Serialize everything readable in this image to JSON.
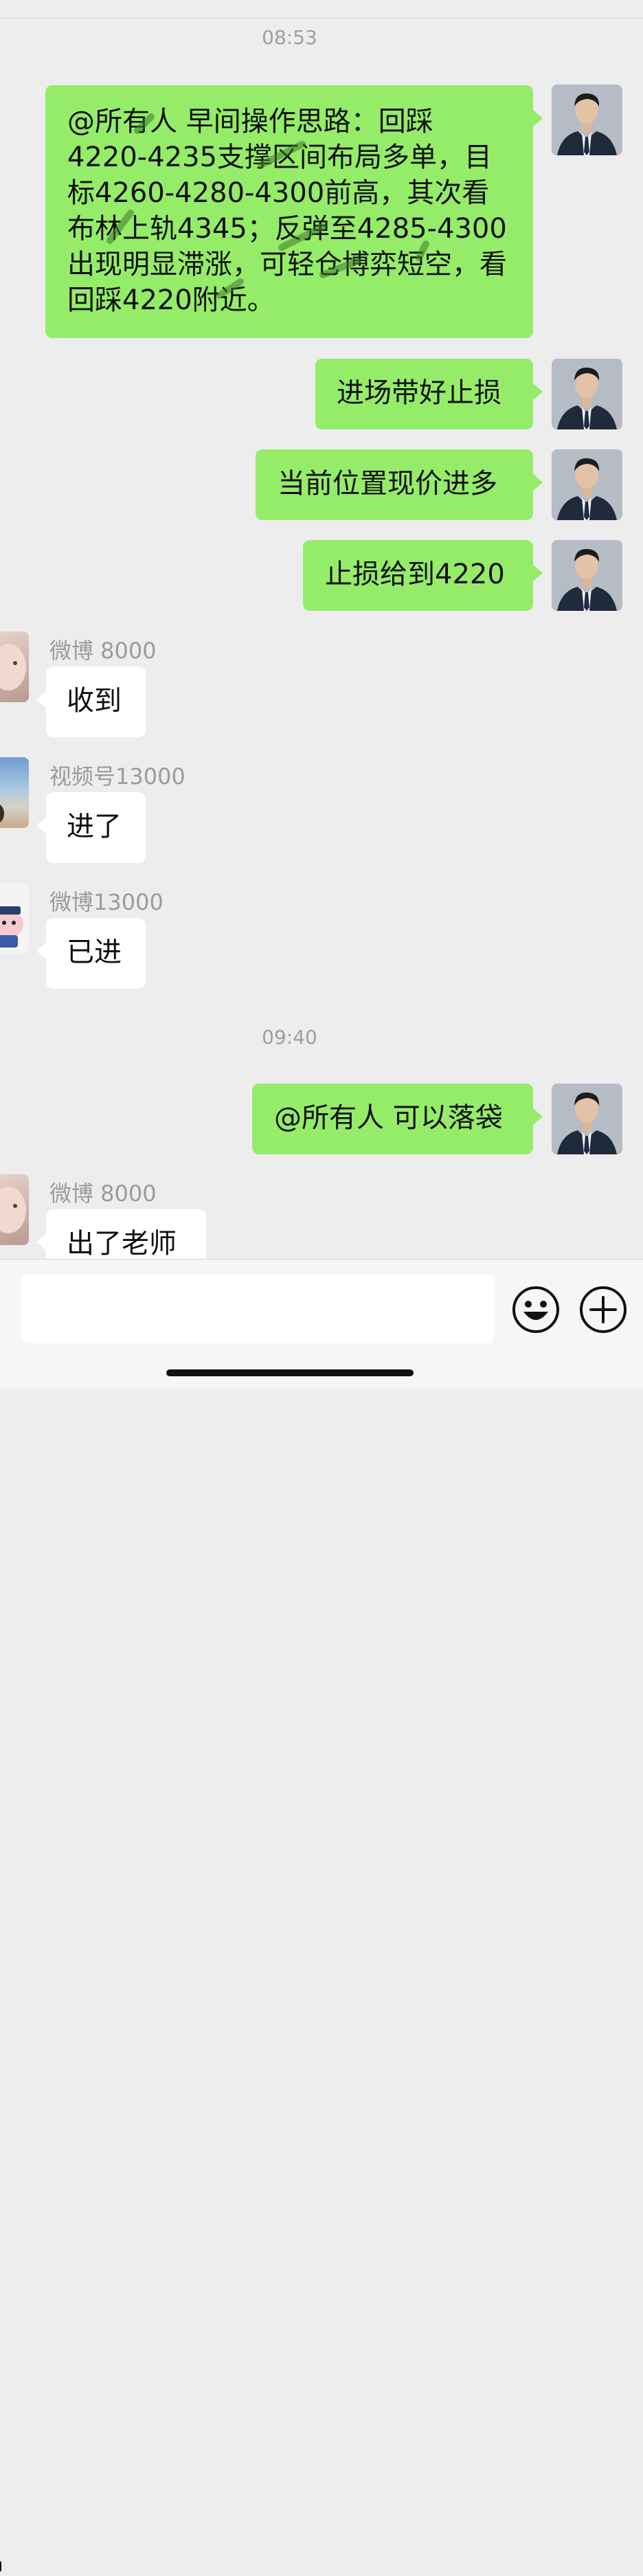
{
  "timestamps": [
    "08:53",
    "09:40"
  ],
  "messages": {
    "m1": {
      "text": "@所有人 早间操作思路：回踩4220-4235支撑区间布局多单，目标4260-4280-4300前高，其次看布林上轨4345；反弹至4285-4300出现明显滞涨，可轻仓博弈短空，看回踩4220附近。"
    },
    "m2": {
      "text": "进场带好止损"
    },
    "m3": {
      "text": "当前位置现价进多"
    },
    "m4": {
      "text": "止损给到4220"
    },
    "m5": {
      "sender": "微博 8000",
      "text": "收到"
    },
    "m6": {
      "sender": "视频号13000",
      "text": "进了"
    },
    "m7": {
      "sender": "微博13000",
      "text": "已进"
    },
    "m8": {
      "text": "@所有人 可以落袋"
    },
    "m9": {
      "sender": "微博 8000",
      "text": "出了老师"
    }
  },
  "icons": {
    "emoji": "smiley-face-icon",
    "more": "plus-circle-icon"
  },
  "colors": {
    "my_bubble": "#95ec69",
    "other_bubble": "#ffffff",
    "background": "#ededed"
  }
}
